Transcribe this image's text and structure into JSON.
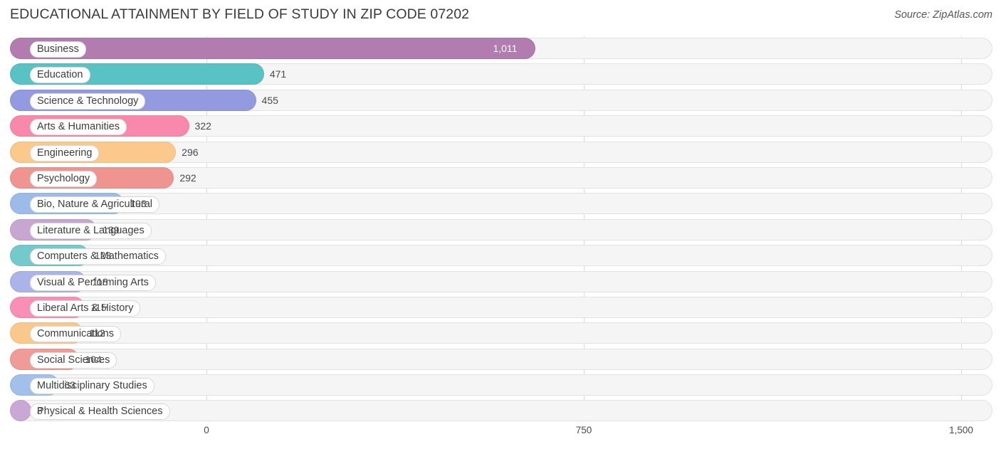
{
  "header": {
    "title": "EDUCATIONAL ATTAINMENT BY FIELD OF STUDY IN ZIP CODE 07202",
    "source": "Source: ZipAtlas.com"
  },
  "chart_data": {
    "type": "bar",
    "orientation": "horizontal",
    "title": "EDUCATIONAL ATTAINMENT BY FIELD OF STUDY IN ZIP CODE 07202",
    "xlabel": "",
    "ylabel": "",
    "xlim": [
      0,
      1500
    ],
    "ticks": [
      "0",
      "750",
      "1,500"
    ],
    "tick_values": [
      0,
      750,
      1500
    ],
    "grid": true,
    "legend": false,
    "categories": [
      "Business",
      "Education",
      "Science & Technology",
      "Arts & Humanities",
      "Engineering",
      "Psychology",
      "Bio, Nature & Agricultural",
      "Literature & Languages",
      "Computers & Mathematics",
      "Visual & Performing Arts",
      "Liberal Arts & History",
      "Communications",
      "Social Sciences",
      "Multidisciplinary Studies",
      "Physical & Health Sciences"
    ],
    "values": [
      1011,
      471,
      455,
      322,
      296,
      292,
      193,
      139,
      123,
      118,
      115,
      112,
      104,
      63,
      8
    ],
    "value_labels": [
      "1,011",
      "471",
      "455",
      "322",
      "296",
      "292",
      "193",
      "139",
      "123",
      "118",
      "115",
      "112",
      "104",
      "63",
      "8"
    ],
    "colors": [
      "#b37cb0",
      "#58c2c4",
      "#939ae0",
      "#f889ac",
      "#fac98b",
      "#ef9491",
      "#9cbbe8",
      "#c7a6d2",
      "#74c9cd",
      "#abb3e8",
      "#f98fb5",
      "#fbc88c",
      "#ef9b97",
      "#a3c0ea",
      "#c9a8d6"
    ]
  }
}
